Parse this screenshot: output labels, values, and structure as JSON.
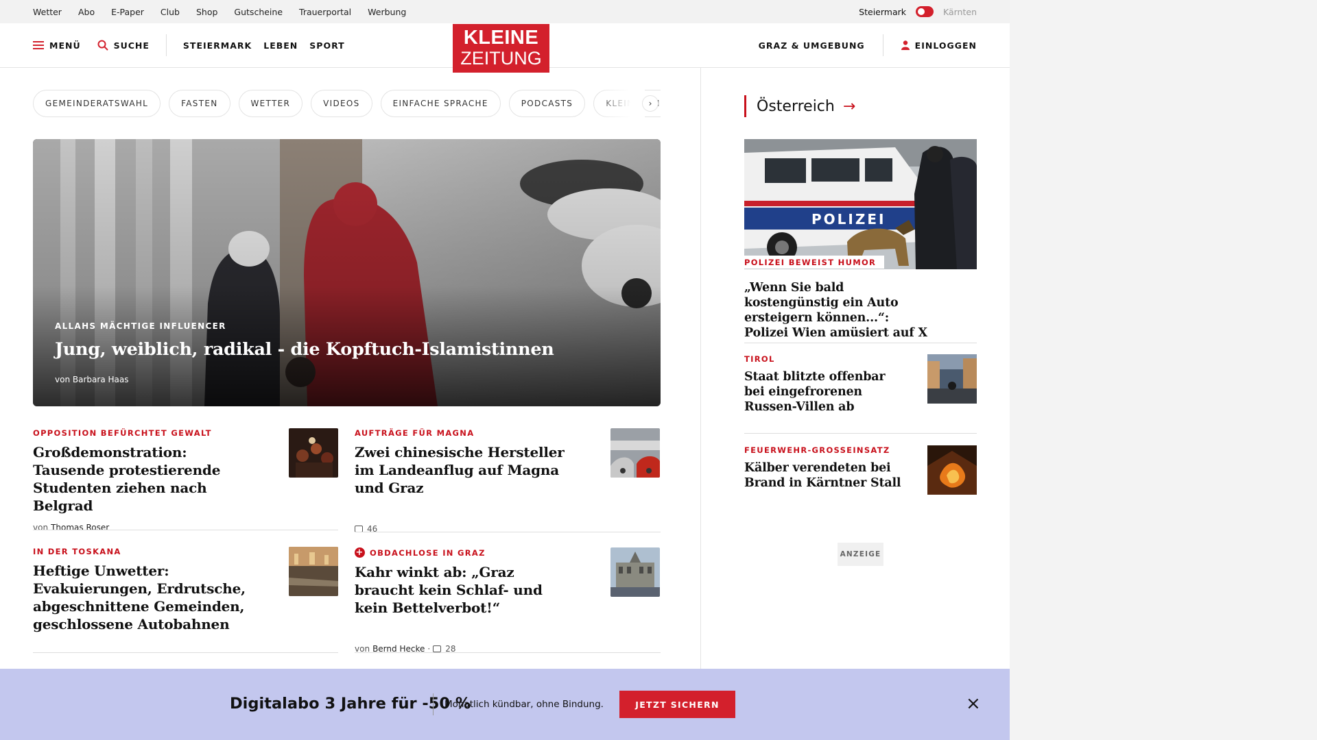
{
  "utility": {
    "links": [
      "Wetter",
      "Abo",
      "E-Paper",
      "Club",
      "Shop",
      "Gutscheine",
      "Trauerportal",
      "Werbung"
    ],
    "region_active": "Steiermark",
    "region_other": "Kärnten"
  },
  "header": {
    "menu": "MENÜ",
    "search": "SUCHE",
    "nav": [
      "STEIERMARK",
      "LEBEN",
      "SPORT"
    ],
    "logo_line1": "KLEINE",
    "logo_line2": "ZEITUNG",
    "region_link": "GRAZ & UMGEBUNG",
    "login": "EINLOGGEN"
  },
  "chips": [
    "GEMEINDERATSWAHL",
    "FASTEN",
    "WETTER",
    "VIDEOS",
    "EINFACHE SPRACHE",
    "PODCASTS",
    "KLEINE KINDER"
  ],
  "chip_next": "›",
  "hero": {
    "kicker": "ALLAHS MÄCHTIGE INFLUENCER",
    "title": "Jung, weiblich, radikal - die Kopftuch-Islamistinnen",
    "author_prefix": "von",
    "author": "Barbara Haas"
  },
  "articles": [
    {
      "kicker": "OPPOSITION BEFÜRCHTET GEWALT",
      "title": "Großdemonstration: Tausende protestierende Studenten ziehen nach Belgrad",
      "author_prefix": "von",
      "author": "Thomas Roser"
    },
    {
      "kicker": "AUFTRÄGE FÜR MAGNA",
      "title": "Zwei chinesische Hersteller im Landeanflug auf Magna und Graz",
      "comments": "46"
    },
    {
      "kicker": "IN DER TOSKANA",
      "title": "Heftige Unwetter: Evakuierungen, Erdrutsche, abgeschnittene Gemeinden, geschlossene Autobahnen"
    },
    {
      "kicker": "OBDACHLOSE IN GRAZ",
      "title": "Kahr winkt ab: „Graz braucht kein Schlaf- und kein Bettelverbot!“",
      "author_prefix": "von",
      "author": "Bernd Hecke",
      "comments": "28",
      "premium_icon": "+"
    }
  ],
  "sidebar": {
    "section_title": "Österreich",
    "arrow": "→",
    "top": {
      "kicker": "POLIZEI BEWEIST HUMOR",
      "title": "„Wenn Sie bald kostengünstig ein Auto ersteigern können...“: Polizei Wien amüsiert auf X",
      "image_text": "POLIZEI"
    },
    "items": [
      {
        "kicker": "TIROL",
        "title": "Staat blitzte offenbar bei eingefrorenen Russen-Villen ab"
      },
      {
        "kicker": "FEUERWEHR-GROSSEINSATZ",
        "title": "Kälber verendeten bei Brand in Kärntner Stall"
      }
    ],
    "ad_label": "ANZEIGE"
  },
  "promo": {
    "title": "Digitalabo 3 Jahre für -50 %",
    "subtitle": "Monatlich kündbar, ohne Bindung.",
    "button": "JETZT SICHERN",
    "close": "×"
  },
  "colors": {
    "brand_red": "#d3202c",
    "kicker_red": "#c8101b",
    "promo_bg": "#c3c7ee"
  }
}
